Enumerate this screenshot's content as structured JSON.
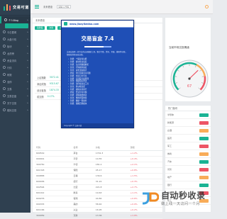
{
  "app": {
    "brand": "交易可道"
  },
  "sidebar": {
    "items": [
      {
        "label": "个人Blog",
        "icon": "user-icon",
        "active": true
      },
      {
        "label": "今日要闻",
        "icon": "news-icon"
      },
      {
        "label": "大盘行情",
        "icon": "chart-icon"
      },
      {
        "label": "板块",
        "icon": "grid-icon"
      },
      {
        "label": "龙虎榜",
        "icon": "trophy-icon"
      },
      {
        "label": "资金流向",
        "icon": "flow-icon"
      },
      {
        "label": "行情",
        "icon": "candle-icon"
      },
      {
        "label": "研报",
        "icon": "doc-icon"
      },
      {
        "label": "涨停",
        "icon": "up-icon"
      },
      {
        "label": "交易",
        "icon": "trade-icon"
      },
      {
        "label": "交易复盘",
        "icon": "review-icon"
      },
      {
        "label": "关于交易",
        "icon": "info-icon"
      },
      {
        "label": "模拟交易",
        "icon": "sim-icon"
      }
    ]
  },
  "topbar": {
    "tab_label": "未来看涨",
    "search_placeholder": "请输入代码"
  },
  "main": {
    "title": "未来看涨",
    "toolbar": [
      "强势股",
      "次新",
      "龙头",
      "查询"
    ],
    "stats": [
      {
        "label": "上证指数",
        "value": "3072.41"
      },
      {
        "label": "深证成指",
        "value": "9315.67"
      },
      {
        "label": "创业板指",
        "value": "1874.33"
      },
      {
        "label": "成交额",
        "value": "0.17%"
      }
    ],
    "table": {
      "headers": [
        "代码",
        "名称",
        "价格",
        "涨幅"
      ],
      "rows": [
        [
          "600519",
          "茅台",
          "1701.3",
          "+1.2%"
        ],
        [
          "000001",
          "平安",
          "10.55",
          "+0.4%"
        ],
        [
          "300750",
          "宁德",
          "181.2",
          "+2.1%"
        ],
        [
          "601318",
          "保险",
          "45.17",
          "+0.8%"
        ],
        [
          "000858",
          "五粮",
          "139.6",
          "+1.5%"
        ],
        [
          "600036",
          "招行",
          "31.22",
          "+0.3%"
        ],
        [
          "002594",
          "比亚",
          "221.8",
          "+2.7%"
        ],
        [
          "601012",
          "隆基",
          "19.63",
          "+1.1%"
        ],
        [
          "600276",
          "恒瑞",
          "44.82",
          "+0.6%"
        ],
        [
          "000333",
          "美的",
          "58.40",
          "+0.9%"
        ],
        [
          "601166",
          "兴业",
          "16.95",
          "+0.2%"
        ],
        [
          "300059",
          "东财",
          "13.36",
          "+1.9%"
        ]
      ]
    }
  },
  "gauge": {
    "title": "当前市场交投情绪",
    "value": 67,
    "max": 100,
    "color_needle": "#ed5565"
  },
  "side_panel": {
    "title": "热门板块",
    "rows": [
      "半导体",
      "新能源",
      "白酒",
      "医药",
      "军工",
      "券商",
      "汽车",
      "光伏",
      "地产",
      "银行",
      "煤炭",
      "化工"
    ]
  },
  "splash": {
    "url": "www.jiaoyikedao.com",
    "title": "交易盲盒 7.4",
    "progress": 0.72,
    "intro": "交易盲盒是一款专业的交易辅助工具，整合行情、资讯、复盘、模拟等功能，帮助投资者高效决策。",
    "items": [
      "新增：个股复盘功能",
      "新增：板块轮动追踪",
      "新增：龙虎榜数据解析",
      "优化：行情刷新速度",
      "优化：资金流向统计",
      "修复：部分页面显示问题",
      "新增：交易日志导出",
      "新增：自选股分组管理",
      "优化：情绪指标算法",
      "新增：涨停板复盘工具",
      "优化：移动端适配",
      "新增：模拟交易排行",
      "修复：登录异常问题",
      "新增：研报摘要推送",
      "优化：整体界面体验",
      "新增：数据一键备份",
      "新增：策略回测模块"
    ],
    "footer": "Copyright © 交易可道"
  },
  "watermark": {
    "title": "自动秒收录",
    "subtitle": "做上线一天访问一个月"
  },
  "colors": {
    "sidebar": "#2f4050",
    "accent": "#1ab394",
    "splash": "#1f4fb6"
  }
}
